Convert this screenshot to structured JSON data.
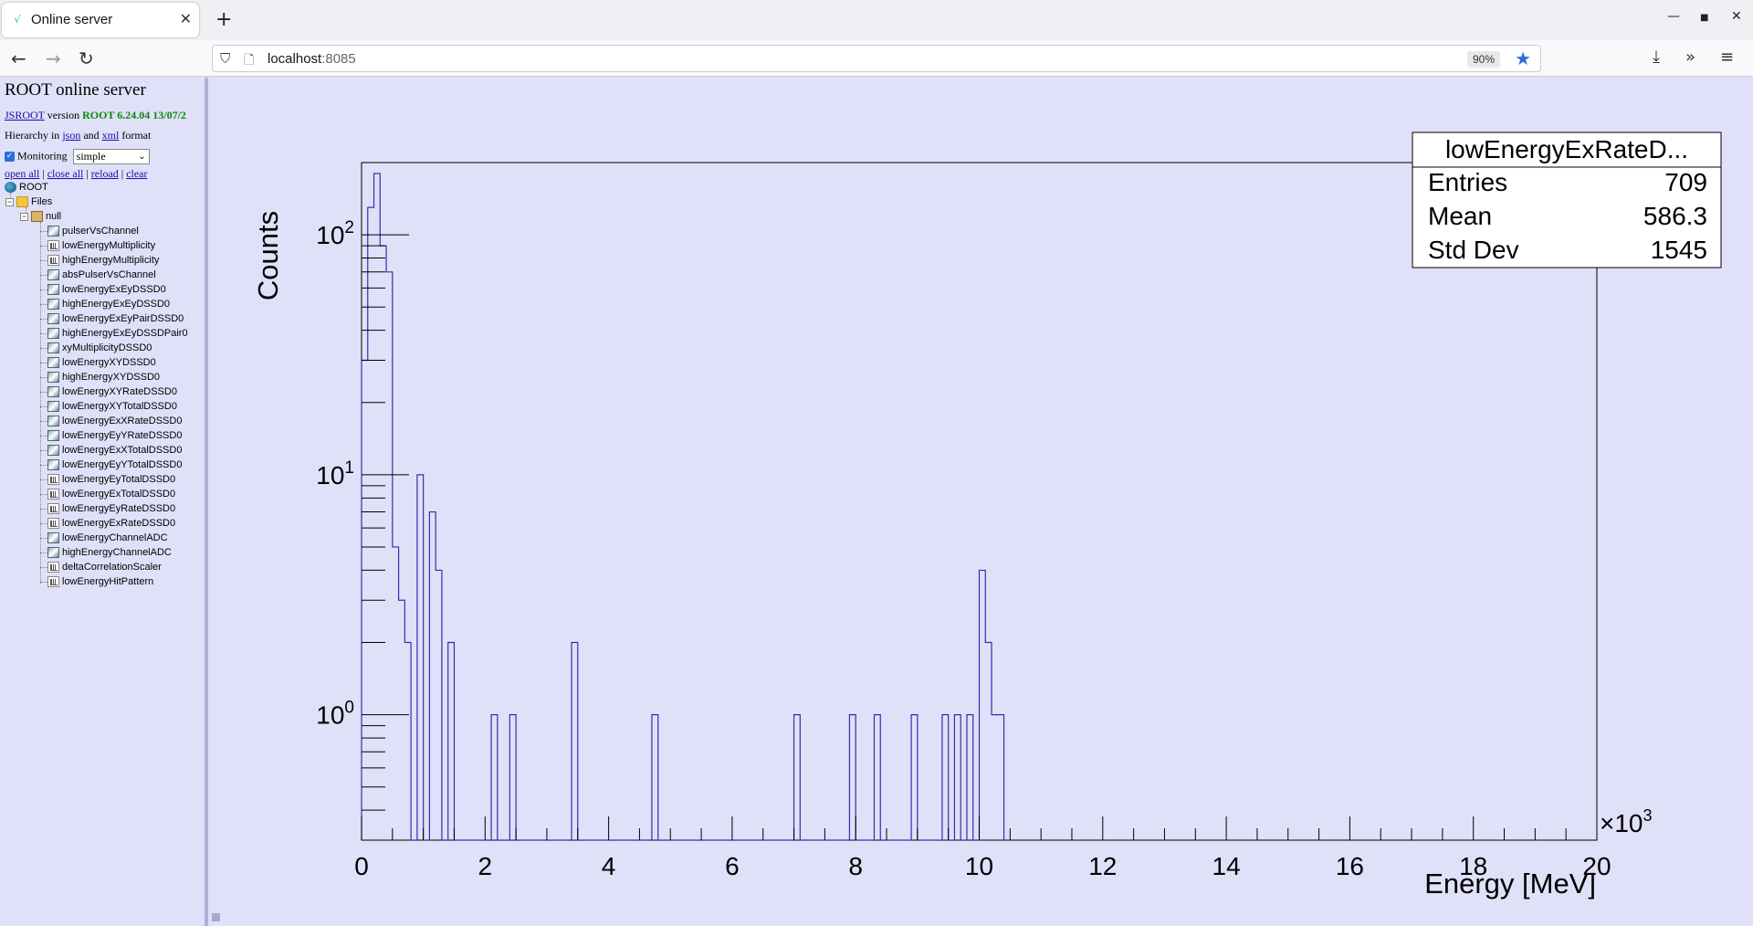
{
  "browser": {
    "tab_title": "Online server",
    "url_host": "localhost",
    "url_port": ":8085",
    "zoom": "90%"
  },
  "sidebar": {
    "title": "ROOT online server",
    "jsroot_link": "JSROOT",
    "version_word": "version",
    "version_value": "ROOT 6.24.04 13/07/2",
    "hierarchy_prefix": "Hierarchy in",
    "json_link": "json",
    "and_word": "and",
    "xml_link": "xml",
    "format_word": "format",
    "monitoring_label": "Monitoring",
    "monitoring_checked": true,
    "monitoring_mode": "simple",
    "actions": [
      "open all",
      "close all",
      "reload",
      "clear"
    ],
    "tree": {
      "root": "ROOT",
      "files": "Files",
      "null": "null",
      "items": [
        {
          "label": "pulserVsChannel",
          "type": "h2"
        },
        {
          "label": "lowEnergyMultiplicity",
          "type": "h1"
        },
        {
          "label": "highEnergyMultiplicity",
          "type": "h1"
        },
        {
          "label": "absPulserVsChannel",
          "type": "h2"
        },
        {
          "label": "lowEnergyExEyDSSD0",
          "type": "h2"
        },
        {
          "label": "highEnergyExEyDSSD0",
          "type": "h2"
        },
        {
          "label": "lowEnergyExEyPairDSSD0",
          "type": "h2"
        },
        {
          "label": "highEnergyExEyDSSDPair0",
          "type": "h2"
        },
        {
          "label": "xyMultiplicityDSSD0",
          "type": "h2"
        },
        {
          "label": "lowEnergyXYDSSD0",
          "type": "h2"
        },
        {
          "label": "highEnergyXYDSSD0",
          "type": "h2"
        },
        {
          "label": "lowEnergyXYRateDSSD0",
          "type": "h2"
        },
        {
          "label": "lowEnergyXYTotalDSSD0",
          "type": "h2"
        },
        {
          "label": "lowEnergyExXRateDSSD0",
          "type": "h2"
        },
        {
          "label": "lowEnergyEyYRateDSSD0",
          "type": "h2"
        },
        {
          "label": "lowEnergyExXTotalDSSD0",
          "type": "h2"
        },
        {
          "label": "lowEnergyEyYTotalDSSD0",
          "type": "h2"
        },
        {
          "label": "lowEnergyEyTotalDSSD0",
          "type": "h1"
        },
        {
          "label": "lowEnergyExTotalDSSD0",
          "type": "h1"
        },
        {
          "label": "lowEnergyEyRateDSSD0",
          "type": "h1"
        },
        {
          "label": "lowEnergyExRateDSSD0",
          "type": "h1"
        },
        {
          "label": "lowEnergyChannelADC",
          "type": "h2"
        },
        {
          "label": "highEnergyChannelADC",
          "type": "h2"
        },
        {
          "label": "deltaCorrelationScaler",
          "type": "h1"
        },
        {
          "label": "lowEnergyHitPattern",
          "type": "h1"
        }
      ]
    }
  },
  "stats": {
    "title": "lowEnergyExRateD...",
    "rows": [
      {
        "label": "Entries",
        "value": "709"
      },
      {
        "label": "Mean",
        "value": "586.3"
      },
      {
        "label": "Std Dev",
        "value": "1545"
      }
    ]
  },
  "colors": {
    "histogram": "#3030b0",
    "frame": "#000000",
    "background": "#e0e0f8"
  },
  "chart_data": {
    "type": "histogram",
    "xlabel": "Energy [MeV]",
    "ylabel": "Counts",
    "x_multiplier": "×10^3",
    "xlim": [
      0,
      20000
    ],
    "ylim": [
      0.3,
      200
    ],
    "y_log": true,
    "x_ticks": [
      0,
      2,
      4,
      6,
      8,
      10,
      12,
      14,
      16,
      18,
      20
    ],
    "y_ticks": [
      "10^0",
      "10^1",
      "10^2"
    ],
    "bin_width": 100,
    "bins": [
      {
        "x": 0,
        "count": 30
      },
      {
        "x": 100,
        "count": 130
      },
      {
        "x": 200,
        "count": 180
      },
      {
        "x": 300,
        "count": 90
      },
      {
        "x": 400,
        "count": 70
      },
      {
        "x": 500,
        "count": 5
      },
      {
        "x": 600,
        "count": 3
      },
      {
        "x": 700,
        "count": 2
      },
      {
        "x": 900,
        "count": 10
      },
      {
        "x": 1100,
        "count": 7
      },
      {
        "x": 1200,
        "count": 4
      },
      {
        "x": 1400,
        "count": 2
      },
      {
        "x": 2100,
        "count": 1
      },
      {
        "x": 2400,
        "count": 1
      },
      {
        "x": 3400,
        "count": 2
      },
      {
        "x": 4700,
        "count": 1
      },
      {
        "x": 7000,
        "count": 1
      },
      {
        "x": 7900,
        "count": 1
      },
      {
        "x": 8300,
        "count": 1
      },
      {
        "x": 8900,
        "count": 1
      },
      {
        "x": 9400,
        "count": 1
      },
      {
        "x": 9600,
        "count": 1
      },
      {
        "x": 9800,
        "count": 1
      },
      {
        "x": 10000,
        "count": 4
      },
      {
        "x": 10100,
        "count": 2
      },
      {
        "x": 10200,
        "count": 1
      },
      {
        "x": 10300,
        "count": 1
      }
    ]
  }
}
